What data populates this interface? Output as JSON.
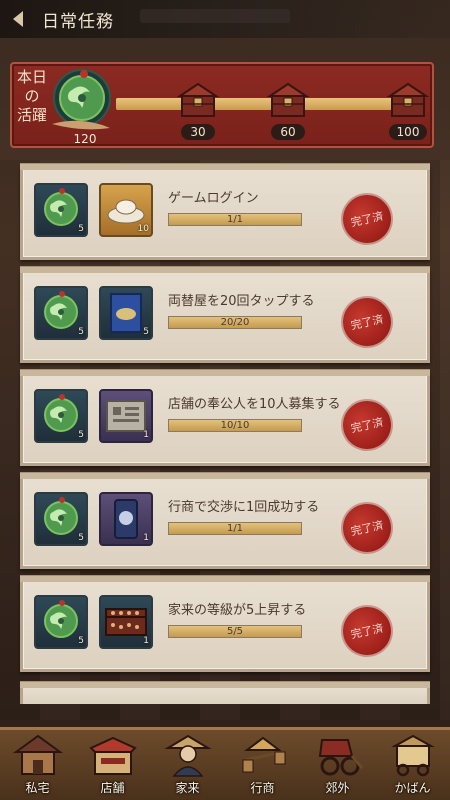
{
  "header": {
    "title": "日常任務"
  },
  "activity": {
    "label_line1": "本日",
    "label_line2": "の",
    "label_line3": "活躍",
    "current": "120",
    "progress": 1.0,
    "milestones": [
      {
        "value": "30"
      },
      {
        "value": "60"
      },
      {
        "value": "100"
      }
    ]
  },
  "tasks": [
    {
      "name": "ゲームログイン",
      "progress": "1/1",
      "fraction": 1.0,
      "reward1_qty": "5",
      "reward2_qty": "10",
      "reward2": "gold-ingot-icon",
      "status": "完了済"
    },
    {
      "name": "両替屋を20回タップする",
      "progress": "20/20",
      "fraction": 1.0,
      "reward1_qty": "5",
      "reward2_qty": "5",
      "reward2": "exchange-card-icon",
      "status": "完了済"
    },
    {
      "name": "店舗の奉公人を10人募集する",
      "progress": "10/10",
      "fraction": 1.0,
      "reward1_qty": "5",
      "reward2_qty": "1",
      "reward2": "recruit-scroll-icon",
      "status": "完了済"
    },
    {
      "name": "行商で交渉に1回成功する",
      "progress": "1/1",
      "fraction": 1.0,
      "reward1_qty": "5",
      "reward2_qty": "1",
      "reward2": "trade-token-icon",
      "status": "完了済"
    },
    {
      "name": "家来の等級が5上昇する",
      "progress": "5/5",
      "fraction": 1.0,
      "reward1_qty": "5",
      "reward2_qty": "1",
      "reward2": "abacus-icon",
      "status": "完了済"
    }
  ],
  "nav": [
    {
      "label": "私宅",
      "icon": "residence-icon"
    },
    {
      "label": "店舗",
      "icon": "shop-icon"
    },
    {
      "label": "家来",
      "icon": "retainer-icon"
    },
    {
      "label": "行商",
      "icon": "peddler-icon"
    },
    {
      "label": "郊外",
      "icon": "rickshaw-icon"
    },
    {
      "label": "かばん",
      "icon": "bag-cart-icon"
    }
  ],
  "colors": {
    "banner": "#8c2a22",
    "stamp": "#b12a22",
    "panel": "#e3d8c8"
  }
}
